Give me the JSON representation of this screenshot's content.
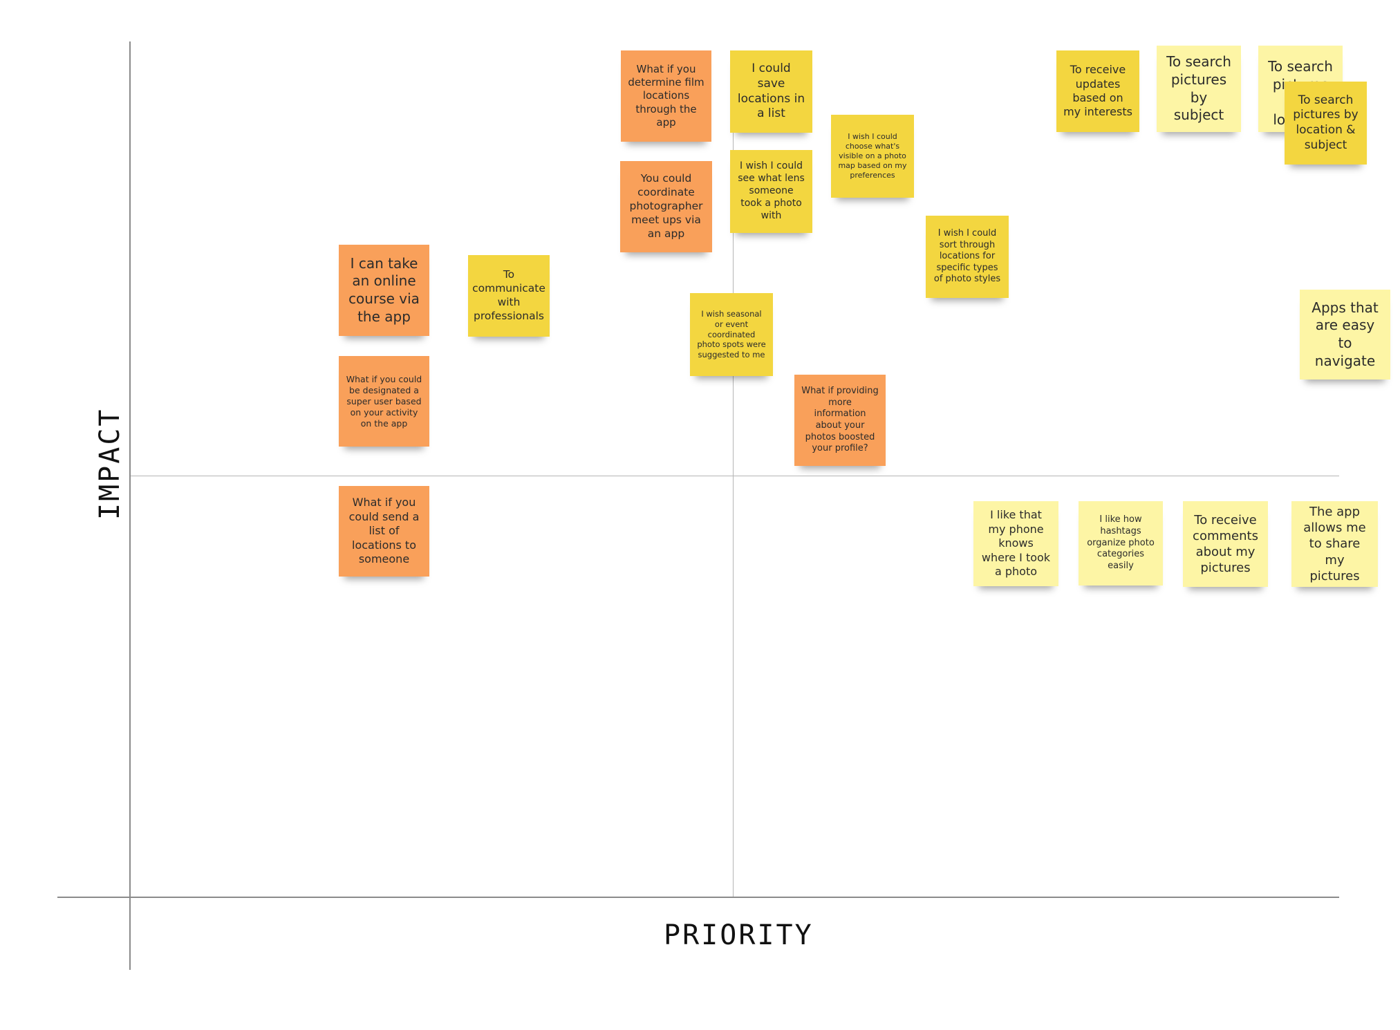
{
  "axes": {
    "x_label": "PRIORITY",
    "y_label": "IMPACT"
  },
  "colors": {
    "orange": "#f9a05a",
    "yellow": "#f3d640",
    "light_yellow": "#fdf5a5",
    "axis": "#8a8a8a"
  },
  "notes": [
    {
      "id": "film-locations",
      "text": "What if you determine film locations through the app",
      "color": "orange"
    },
    {
      "id": "save-locations",
      "text": "I could save locations in a list",
      "color": "yellow"
    },
    {
      "id": "coordinate-meetups",
      "text": "You could coordinate photographer meet ups via an app",
      "color": "orange"
    },
    {
      "id": "lens-info",
      "text": "I wish I could see what lens someone took a photo with",
      "color": "yellow"
    },
    {
      "id": "photo-map-prefs",
      "text": "I wish I could choose what's visible on a photo map based on my preferences",
      "color": "yellow"
    },
    {
      "id": "updates-interests",
      "text": "To receive updates based on my interests",
      "color": "yellow"
    },
    {
      "id": "search-subject",
      "text": "To search pictures by subject",
      "color": "light_yellow"
    },
    {
      "id": "search-location-back",
      "text": "To search pictures by location",
      "color": "light_yellow"
    },
    {
      "id": "search-location-subject",
      "text": "To search pictures by location & subject",
      "color": "yellow"
    },
    {
      "id": "sort-photo-styles",
      "text": "I wish I could sort through locations for specific types of photo styles",
      "color": "yellow"
    },
    {
      "id": "online-course",
      "text": "I can take an online course via the app",
      "color": "orange"
    },
    {
      "id": "communicate-pros",
      "text": "To communicate with professionals",
      "color": "yellow"
    },
    {
      "id": "seasonal-spots",
      "text": "I wish seasonal or event coordinated photo spots were suggested to me",
      "color": "yellow"
    },
    {
      "id": "easy-navigate",
      "text": "Apps that are easy to navigate",
      "color": "light_yellow"
    },
    {
      "id": "super-user",
      "text": "What if you could be designated a super user based on your activity on the app",
      "color": "orange"
    },
    {
      "id": "profile-boost",
      "text": "What if providing more information about your photos boosted your profile?",
      "color": "orange"
    },
    {
      "id": "send-list",
      "text": "What if you could send a list of locations to someone",
      "color": "orange"
    },
    {
      "id": "phone-knows",
      "text": "I like that my phone knows where I took a photo",
      "color": "light_yellow"
    },
    {
      "id": "hashtags",
      "text": "I like how hashtags organize photo categories easily",
      "color": "light_yellow"
    },
    {
      "id": "receive-comments",
      "text": "To receive comments about my pictures",
      "color": "light_yellow"
    },
    {
      "id": "share-pictures",
      "text": "The app allows me to share my pictures",
      "color": "light_yellow"
    }
  ]
}
